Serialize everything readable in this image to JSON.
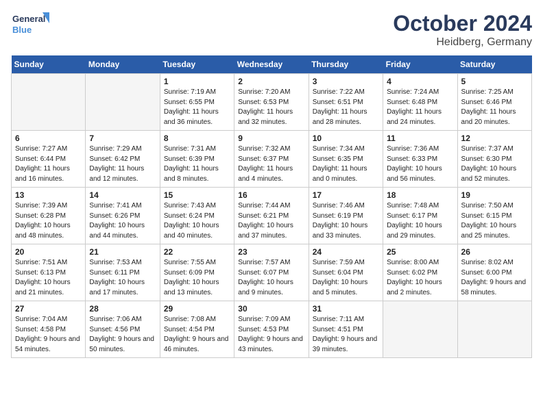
{
  "header": {
    "logo_line1": "General",
    "logo_line2": "Blue",
    "month": "October 2024",
    "location": "Heidberg, Germany"
  },
  "weekdays": [
    "Sunday",
    "Monday",
    "Tuesday",
    "Wednesday",
    "Thursday",
    "Friday",
    "Saturday"
  ],
  "weeks": [
    [
      {
        "day": "",
        "empty": true
      },
      {
        "day": "",
        "empty": true
      },
      {
        "day": "1",
        "sunrise": "Sunrise: 7:19 AM",
        "sunset": "Sunset: 6:55 PM",
        "daylight": "Daylight: 11 hours and 36 minutes."
      },
      {
        "day": "2",
        "sunrise": "Sunrise: 7:20 AM",
        "sunset": "Sunset: 6:53 PM",
        "daylight": "Daylight: 11 hours and 32 minutes."
      },
      {
        "day": "3",
        "sunrise": "Sunrise: 7:22 AM",
        "sunset": "Sunset: 6:51 PM",
        "daylight": "Daylight: 11 hours and 28 minutes."
      },
      {
        "day": "4",
        "sunrise": "Sunrise: 7:24 AM",
        "sunset": "Sunset: 6:48 PM",
        "daylight": "Daylight: 11 hours and 24 minutes."
      },
      {
        "day": "5",
        "sunrise": "Sunrise: 7:25 AM",
        "sunset": "Sunset: 6:46 PM",
        "daylight": "Daylight: 11 hours and 20 minutes."
      }
    ],
    [
      {
        "day": "6",
        "sunrise": "Sunrise: 7:27 AM",
        "sunset": "Sunset: 6:44 PM",
        "daylight": "Daylight: 11 hours and 16 minutes."
      },
      {
        "day": "7",
        "sunrise": "Sunrise: 7:29 AM",
        "sunset": "Sunset: 6:42 PM",
        "daylight": "Daylight: 11 hours and 12 minutes."
      },
      {
        "day": "8",
        "sunrise": "Sunrise: 7:31 AM",
        "sunset": "Sunset: 6:39 PM",
        "daylight": "Daylight: 11 hours and 8 minutes."
      },
      {
        "day": "9",
        "sunrise": "Sunrise: 7:32 AM",
        "sunset": "Sunset: 6:37 PM",
        "daylight": "Daylight: 11 hours and 4 minutes."
      },
      {
        "day": "10",
        "sunrise": "Sunrise: 7:34 AM",
        "sunset": "Sunset: 6:35 PM",
        "daylight": "Daylight: 11 hours and 0 minutes."
      },
      {
        "day": "11",
        "sunrise": "Sunrise: 7:36 AM",
        "sunset": "Sunset: 6:33 PM",
        "daylight": "Daylight: 10 hours and 56 minutes."
      },
      {
        "day": "12",
        "sunrise": "Sunrise: 7:37 AM",
        "sunset": "Sunset: 6:30 PM",
        "daylight": "Daylight: 10 hours and 52 minutes."
      }
    ],
    [
      {
        "day": "13",
        "sunrise": "Sunrise: 7:39 AM",
        "sunset": "Sunset: 6:28 PM",
        "daylight": "Daylight: 10 hours and 48 minutes."
      },
      {
        "day": "14",
        "sunrise": "Sunrise: 7:41 AM",
        "sunset": "Sunset: 6:26 PM",
        "daylight": "Daylight: 10 hours and 44 minutes."
      },
      {
        "day": "15",
        "sunrise": "Sunrise: 7:43 AM",
        "sunset": "Sunset: 6:24 PM",
        "daylight": "Daylight: 10 hours and 40 minutes."
      },
      {
        "day": "16",
        "sunrise": "Sunrise: 7:44 AM",
        "sunset": "Sunset: 6:21 PM",
        "daylight": "Daylight: 10 hours and 37 minutes."
      },
      {
        "day": "17",
        "sunrise": "Sunrise: 7:46 AM",
        "sunset": "Sunset: 6:19 PM",
        "daylight": "Daylight: 10 hours and 33 minutes."
      },
      {
        "day": "18",
        "sunrise": "Sunrise: 7:48 AM",
        "sunset": "Sunset: 6:17 PM",
        "daylight": "Daylight: 10 hours and 29 minutes."
      },
      {
        "day": "19",
        "sunrise": "Sunrise: 7:50 AM",
        "sunset": "Sunset: 6:15 PM",
        "daylight": "Daylight: 10 hours and 25 minutes."
      }
    ],
    [
      {
        "day": "20",
        "sunrise": "Sunrise: 7:51 AM",
        "sunset": "Sunset: 6:13 PM",
        "daylight": "Daylight: 10 hours and 21 minutes."
      },
      {
        "day": "21",
        "sunrise": "Sunrise: 7:53 AM",
        "sunset": "Sunset: 6:11 PM",
        "daylight": "Daylight: 10 hours and 17 minutes."
      },
      {
        "day": "22",
        "sunrise": "Sunrise: 7:55 AM",
        "sunset": "Sunset: 6:09 PM",
        "daylight": "Daylight: 10 hours and 13 minutes."
      },
      {
        "day": "23",
        "sunrise": "Sunrise: 7:57 AM",
        "sunset": "Sunset: 6:07 PM",
        "daylight": "Daylight: 10 hours and 9 minutes."
      },
      {
        "day": "24",
        "sunrise": "Sunrise: 7:59 AM",
        "sunset": "Sunset: 6:04 PM",
        "daylight": "Daylight: 10 hours and 5 minutes."
      },
      {
        "day": "25",
        "sunrise": "Sunrise: 8:00 AM",
        "sunset": "Sunset: 6:02 PM",
        "daylight": "Daylight: 10 hours and 2 minutes."
      },
      {
        "day": "26",
        "sunrise": "Sunrise: 8:02 AM",
        "sunset": "Sunset: 6:00 PM",
        "daylight": "Daylight: 9 hours and 58 minutes."
      }
    ],
    [
      {
        "day": "27",
        "sunrise": "Sunrise: 7:04 AM",
        "sunset": "Sunset: 4:58 PM",
        "daylight": "Daylight: 9 hours and 54 minutes."
      },
      {
        "day": "28",
        "sunrise": "Sunrise: 7:06 AM",
        "sunset": "Sunset: 4:56 PM",
        "daylight": "Daylight: 9 hours and 50 minutes."
      },
      {
        "day": "29",
        "sunrise": "Sunrise: 7:08 AM",
        "sunset": "Sunset: 4:54 PM",
        "daylight": "Daylight: 9 hours and 46 minutes."
      },
      {
        "day": "30",
        "sunrise": "Sunrise: 7:09 AM",
        "sunset": "Sunset: 4:53 PM",
        "daylight": "Daylight: 9 hours and 43 minutes."
      },
      {
        "day": "31",
        "sunrise": "Sunrise: 7:11 AM",
        "sunset": "Sunset: 4:51 PM",
        "daylight": "Daylight: 9 hours and 39 minutes."
      },
      {
        "day": "",
        "empty": true
      },
      {
        "day": "",
        "empty": true
      }
    ]
  ]
}
